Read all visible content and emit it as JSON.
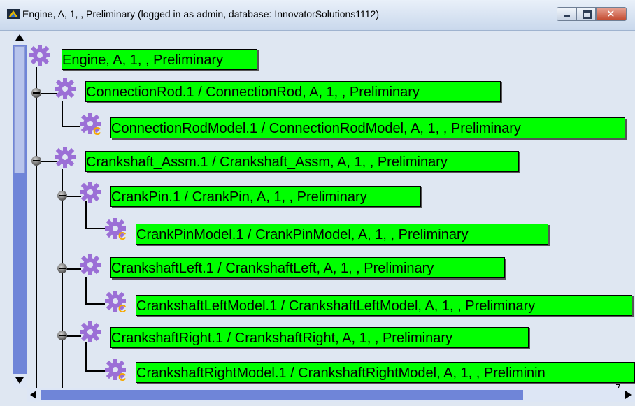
{
  "window": {
    "title": "Engine, A, 1, , Preliminary (logged in as admin, database: InnovatorSolutions1112)"
  },
  "colors": {
    "label_bg": "#00ff00",
    "gear": "#9b6fd6",
    "badge": "#f5a800",
    "scroll": "#6f85d8"
  },
  "tree": {
    "root": "Engine, A, 1, , Preliminary",
    "n1": "ConnectionRod.1 / ConnectionRod, A, 1, , Preliminary",
    "n1a": "ConnectionRodModel.1 / ConnectionRodModel, A, 1, , Preliminary",
    "n2": "Crankshaft_Assm.1 / Crankshaft_Assm, A, 1, , Preliminary",
    "n2a": "CrankPin.1 / CrankPin, A, 1, , Preliminary",
    "n2a1": "CrankPinModel.1 / CrankPinModel, A, 1, , Preliminary",
    "n2b": "CrankshaftLeft.1 / CrankshaftLeft, A, 1, , Preliminary",
    "n2b1": "CrankshaftLeftModel.1 / CrankshaftLeftModel, A, 1, , Preliminary",
    "n2c": "CrankshaftRight.1 / CrankshaftRight, A, 1, , Preliminary",
    "n2c1": "CrankshaftRightModel.1 / CrankshaftRightModel, A, 1, , Preliminin"
  },
  "stray": {
    "mark": "7",
    "mark2": "’"
  },
  "icons": {
    "gear": "gear-icon",
    "model": "model-gear-icon",
    "expander": "collapse-icon"
  }
}
